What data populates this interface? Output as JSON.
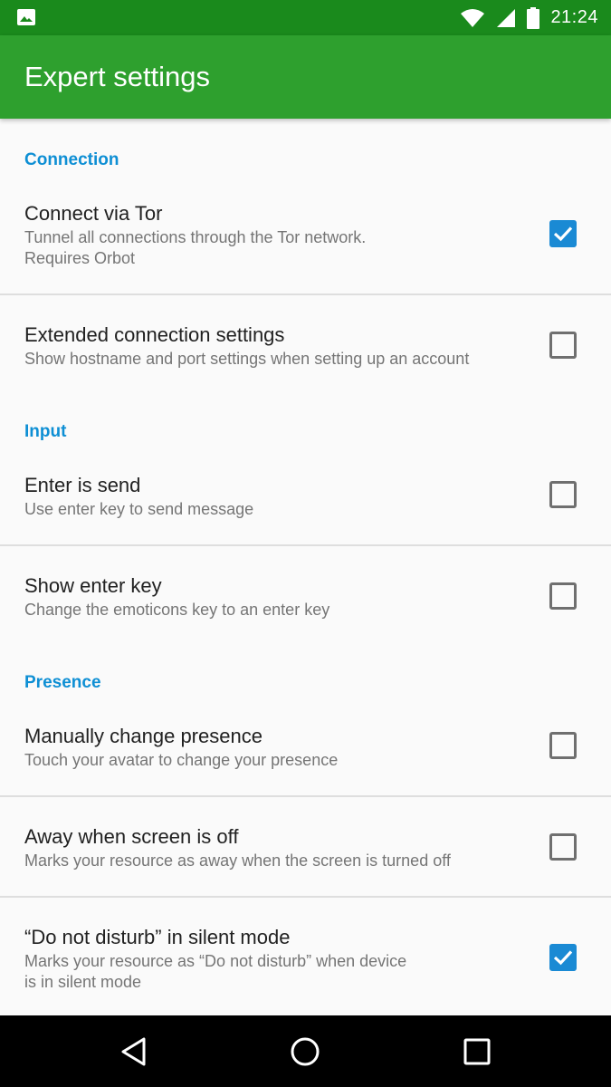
{
  "status_bar": {
    "time": "21:24",
    "icons": [
      "image-icon",
      "wifi-icon",
      "signal-icon",
      "battery-icon"
    ]
  },
  "app_bar": {
    "title": "Expert settings"
  },
  "sections": {
    "connection": {
      "header": "Connection",
      "tor": {
        "title": "Connect via Tor",
        "summary_1": "Tunnel all connections through the Tor network.",
        "summary_2": "Requires Orbot",
        "checked": true
      },
      "extended": {
        "title": "Extended connection settings",
        "summary": "Show hostname and port settings when setting up an account",
        "checked": false
      }
    },
    "input": {
      "header": "Input",
      "enter_send": {
        "title": "Enter is send",
        "summary": "Use enter key to send message",
        "checked": false
      },
      "show_enter": {
        "title": "Show enter key",
        "summary": "Change the emoticons key to an enter key",
        "checked": false
      }
    },
    "presence": {
      "header": "Presence",
      "manual": {
        "title": "Manually change presence",
        "summary": "Touch your avatar to change your presence",
        "checked": false
      },
      "away": {
        "title": "Away when screen is off",
        "summary": "Marks your resource as away when the screen is turned off",
        "checked": false
      },
      "dnd": {
        "title": "“Do not disturb” in silent mode",
        "summary_1": "Marks your resource as “Do not disturb” when device",
        "summary_2": "is in silent mode",
        "checked": true
      }
    }
  },
  "colors": {
    "status_bar": "#1a8a1c",
    "app_bar": "#2ea02e",
    "accent": "#0e8fd4",
    "checkbox_on": "#1a8ad4"
  },
  "nav_bar": {
    "icons": [
      "back-icon",
      "home-icon",
      "recents-icon"
    ]
  }
}
